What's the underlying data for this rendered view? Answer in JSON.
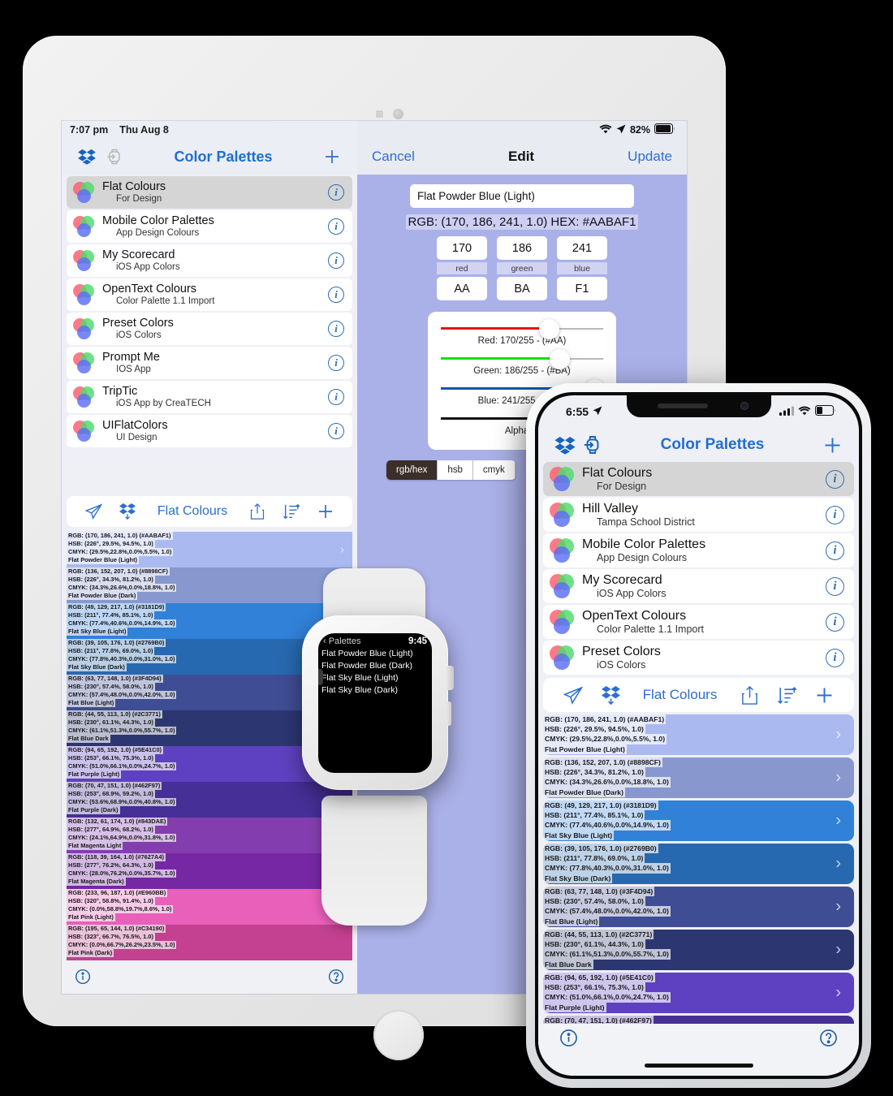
{
  "ipad": {
    "status": {
      "time": "7:07 pm",
      "date": "Thu Aug 8"
    },
    "nav": {
      "title": "Color Palettes",
      "dropbox_icon": "dropbox-icon",
      "watch_icon": "watch-icon",
      "add_icon": "plus-icon"
    },
    "palettes": [
      {
        "title": "Flat Colours",
        "subtitle": "For Design",
        "selected": true
      },
      {
        "title": "Mobile Color Palettes",
        "subtitle": "App Design Colours",
        "selected": false
      },
      {
        "title": "My Scorecard",
        "subtitle": "iOS App Colors",
        "selected": false
      },
      {
        "title": "OpenText Colours",
        "subtitle": "Color Palette 1.1 Import",
        "selected": false
      },
      {
        "title": "Preset Colors",
        "subtitle": "iOS Colors",
        "selected": false
      },
      {
        "title": "Prompt Me",
        "subtitle": "IOS App",
        "selected": false
      },
      {
        "title": "TripTic",
        "subtitle": "iOS App by CreaTECH",
        "selected": false
      },
      {
        "title": "UIFlatColors",
        "subtitle": "UI Design",
        "selected": false
      }
    ],
    "color_toolbar": {
      "send_icon": "paper-plane-icon",
      "dropbox_icon": "dropbox-download-icon",
      "title": "Flat Colours",
      "share_icon": "share-icon",
      "sort_icon": "sort-icon",
      "add_icon": "plus-icon"
    },
    "bottom_bar": {
      "info_icon": "info-icon",
      "help_icon": "help-icon"
    }
  },
  "colors": [
    {
      "rgb": "RGB: (170, 186, 241, 1.0) (#AABAF1)",
      "hsb": "HSB: (226°, 29.5%, 94.5%, 1.0)",
      "cmyk": "CMYK: (29.5%,22.8%,0.0%,5.5%, 1.0)",
      "name": "Flat Powder Blue (Light)",
      "hex": "#AABAF1"
    },
    {
      "rgb": "RGB: (136, 152, 207, 1.0) (#8898CF)",
      "hsb": "HSB: (226°, 34.3%, 81.2%, 1.0)",
      "cmyk": "CMYK: (34.3%,26.6%,0.0%,18.8%, 1.0)",
      "name": "Flat Powder Blue (Dark)",
      "hex": "#8898CF"
    },
    {
      "rgb": "RGB: (49, 129, 217, 1.0) (#3181D9)",
      "hsb": "HSB: (211°, 77.4%, 85.1%, 1.0)",
      "cmyk": "CMYK: (77.4%,40.6%,0.0%,14.9%, 1.0)",
      "name": "Flat Sky Blue (Light)",
      "hex": "#3181D9"
    },
    {
      "rgb": "RGB: (39, 105, 176, 1.0) (#2769B0)",
      "hsb": "HSB: (211°, 77.8%, 69.0%, 1.0)",
      "cmyk": "CMYK: (77.8%,40.3%,0.0%,31.0%, 1.0)",
      "name": "Flat Sky Blue (Dark)",
      "hex": "#2769B0"
    },
    {
      "rgb": "RGB: (63, 77, 148, 1.0) (#3F4D94)",
      "hsb": "HSB: (230°, 57.4%, 58.0%, 1.0)",
      "cmyk": "CMYK: (57.4%,48.0%,0.0%,42.0%, 1.0)",
      "name": "Flat Blue (Light)",
      "hex": "#3F4D94"
    },
    {
      "rgb": "RGB: (44, 55, 113, 1.0) (#2C3771)",
      "hsb": "HSB: (230°, 61.1%, 44.3%, 1.0)",
      "cmyk": "CMYK: (61.1%,51.3%,0.0%,55.7%, 1.0)",
      "name": "Flat Blue Dark",
      "hex": "#2C3771"
    },
    {
      "rgb": "RGB: (94, 65, 192, 1.0) (#5E41C0)",
      "hsb": "HSB: (253°, 66.1%, 75.3%, 1.0)",
      "cmyk": "CMYK: (51.0%,66.1%,0.0%,24.7%, 1.0)",
      "name": "Flat Purple (Light)",
      "hex": "#5E41C0"
    },
    {
      "rgb": "RGB: (70, 47, 151, 1.0) (#462F97)",
      "hsb": "HSB: (253°, 68.9%, 59.2%, 1.0)",
      "cmyk": "CMYK: (53.6%,68.9%,0.0%,40.8%, 1.0)",
      "name": "Flat Purple (Dark)",
      "hex": "#462F97"
    },
    {
      "rgb": "RGB: (132, 61, 174, 1.0) (#843DAE)",
      "hsb": "HSB: (277°, 64.9%, 68.2%, 1.0)",
      "cmyk": "CMYK: (24.1%,64.9%,0.0%,31.8%, 1.0)",
      "name": "Flat Magenta Light",
      "hex": "#843DAE"
    },
    {
      "rgb": "RGB: (118, 39, 164, 1.0) (#7627A4)",
      "hsb": "HSB: (277°, 76.2%, 64.3%, 1.0)",
      "cmyk": "CMYK: (28.0%,76.2%,0.0%,35.7%, 1.0)",
      "name": "Flat Magenta (Dark)",
      "hex": "#7627A4"
    },
    {
      "rgb": "RGB: (233, 96, 187, 1.0) (#E960BB)",
      "hsb": "HSB: (320°, 58.8%, 91.4%, 1.0)",
      "cmyk": "CMYK: (0.0%,58.8%,19.7%,8.6%, 1.0)",
      "name": "Flat Pink (Light)",
      "hex": "#E960BB"
    },
    {
      "rgb": "RGB: (195, 65, 144, 1.0) (#C34190)",
      "hsb": "HSB: (323°, 66.7%, 76.5%, 1.0)",
      "cmyk": "CMYK: (0.0%,66.7%,26.2%,23.5%, 1.0)",
      "name": "Flat Pink (Dark)",
      "hex": "#C34190"
    }
  ],
  "edit": {
    "status": {
      "wifi_icon": "wifi-icon",
      "location_icon": "location-arrow-icon",
      "battery": "82%",
      "battery_icon": "battery-icon"
    },
    "cancel": "Cancel",
    "title": "Edit",
    "update": "Update",
    "name_value": "Flat Powder Blue (Light)",
    "rgb_hex_line": "RGB: (170, 186, 241, 1.0) HEX: #AABAF1",
    "channels": [
      {
        "value": "170",
        "label": "red",
        "hex": "AA"
      },
      {
        "value": "186",
        "label": "green",
        "hex": "BA"
      },
      {
        "value": "241",
        "label": "blue",
        "hex": "F1"
      }
    ],
    "sliders": [
      {
        "label": "Red: 170/255 - (#AA)",
        "pct": 66.7,
        "color": "#e81313"
      },
      {
        "label": "Green: 186/255 - (#BA)",
        "pct": 72.9,
        "color": "#12e012"
      },
      {
        "label": "Blue: 241/255 - (#F1)",
        "pct": 94.5,
        "color": "#1552b0"
      },
      {
        "label": "Alpha: 1",
        "pct": 100,
        "color": "#111111"
      }
    ],
    "segments": [
      {
        "label": "rgb/hex",
        "active": true
      },
      {
        "label": "hsb",
        "active": false
      },
      {
        "label": "cmyk",
        "active": false
      }
    ]
  },
  "iphone": {
    "status": {
      "time": "6:55",
      "location_icon": "location-arrow-icon",
      "cellular_icon": "cellular-bars-icon",
      "wifi_icon": "wifi-icon",
      "battery_icon": "battery-icon"
    },
    "nav": {
      "title": "Color Palettes",
      "dropbox_icon": "dropbox-icon",
      "watch_icon": "watch-icon",
      "add_icon": "plus-icon"
    },
    "palettes": [
      {
        "title": "Flat Colours",
        "subtitle": "For Design",
        "selected": true
      },
      {
        "title": "Hill Valley",
        "subtitle": "Tampa School District",
        "selected": false
      },
      {
        "title": "Mobile Color Palettes",
        "subtitle": "App Design Colours",
        "selected": false
      },
      {
        "title": "My Scorecard",
        "subtitle": "iOS App Colors",
        "selected": false
      },
      {
        "title": "OpenText Colours",
        "subtitle": "Color Palette 1.1 Import",
        "selected": false
      },
      {
        "title": "Preset Colors",
        "subtitle": "iOS Colors",
        "selected": false
      }
    ],
    "color_toolbar": {
      "send_icon": "paper-plane-icon",
      "dropbox_icon": "dropbox-download-icon",
      "title": "Flat Colours",
      "share_icon": "share-icon",
      "sort_icon": "sort-icon",
      "add_icon": "plus-icon"
    },
    "bottom_bar": {
      "info_icon": "info-icon",
      "help_icon": "help-icon"
    }
  },
  "watch": {
    "back_label": "Palettes",
    "time": "9:45",
    "items": [
      {
        "name": "Flat Powder Blue (Light)",
        "hex": "#AABAF1"
      },
      {
        "name": "Flat Powder Blue (Dark)",
        "hex": "#8898CF"
      },
      {
        "name": "Flat Sky Blue (Light)",
        "hex": "#3181D9"
      },
      {
        "name": "Flat Sky Blue (Dark)",
        "hex": "#2769B0"
      }
    ]
  },
  "theme": {
    "accent": "#2b6fd0",
    "ipad_detail_bg": "#AAB0E8",
    "list_bg": "#EEF0F6"
  }
}
